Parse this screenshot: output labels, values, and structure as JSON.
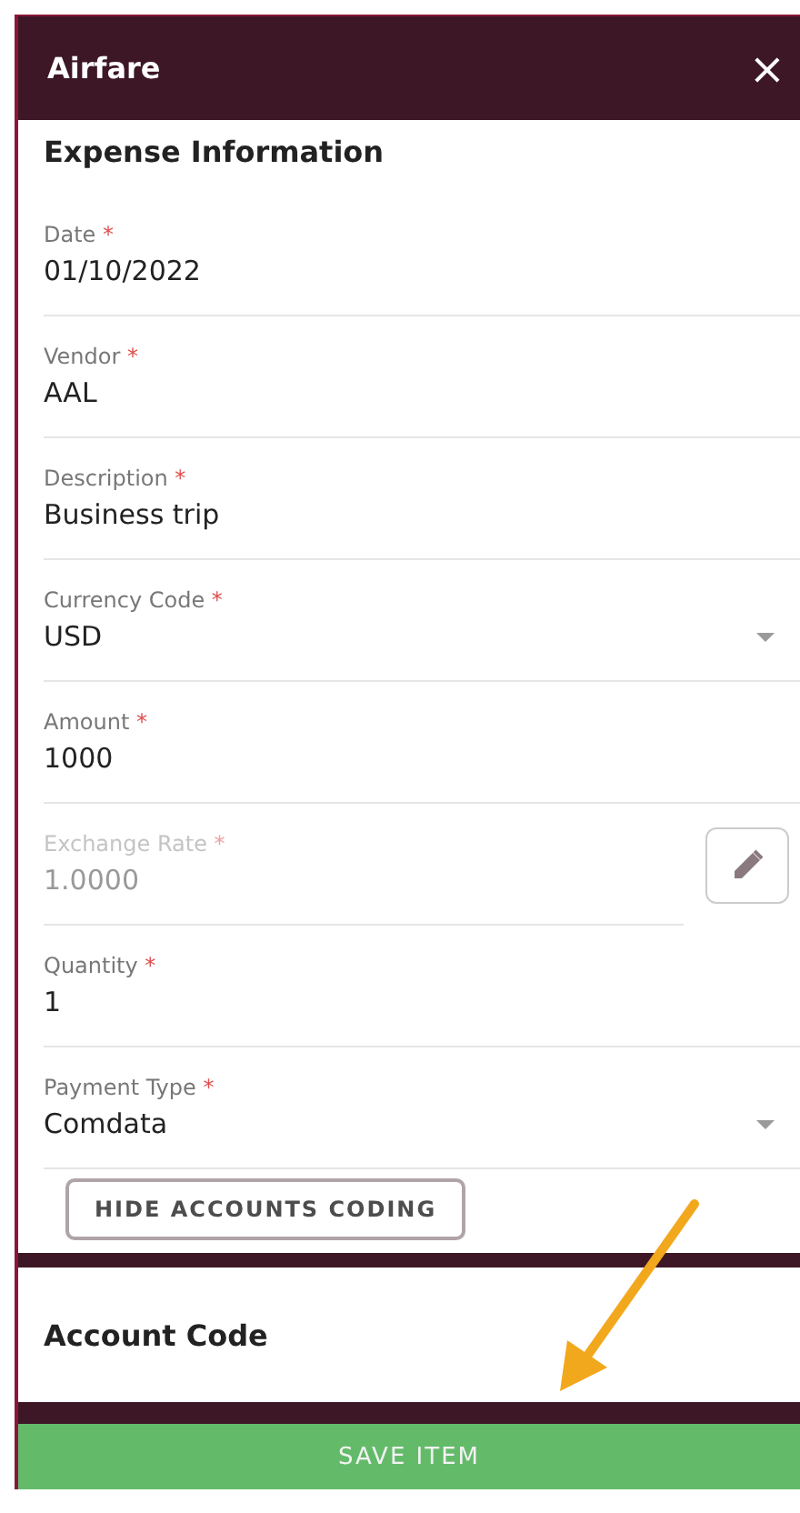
{
  "header": {
    "title": "Airfare",
    "close": "×"
  },
  "section": {
    "title": "Expense Information"
  },
  "fields": [
    {
      "kind": "text",
      "label": "Date",
      "required_mark": "*",
      "value": "01/10/2022",
      "disabled": false
    },
    {
      "kind": "text",
      "label": "Vendor",
      "required_mark": "*",
      "value": "AAL",
      "disabled": false
    },
    {
      "kind": "text",
      "label": "Description",
      "required_mark": "*",
      "value": "Business trip",
      "disabled": false
    },
    {
      "kind": "select",
      "label": "Currency Code",
      "required_mark": "*",
      "value": "USD",
      "disabled": false
    },
    {
      "kind": "text",
      "label": "Amount",
      "required_mark": "*",
      "value": "1000",
      "disabled": false
    },
    {
      "kind": "editable",
      "label": "Exchange Rate",
      "required_mark": "*",
      "value": "1.0000",
      "disabled": true
    },
    {
      "kind": "text",
      "label": "Quantity",
      "required_mark": "*",
      "value": "1",
      "disabled": false
    },
    {
      "kind": "select",
      "label": "Payment Type",
      "required_mark": "*",
      "value": "Comdata",
      "disabled": false
    }
  ],
  "toggle_button": "HIDE ACCOUNTS CODING",
  "account_section": {
    "title": "Account Code"
  },
  "save_button": "SAVE ITEM"
}
